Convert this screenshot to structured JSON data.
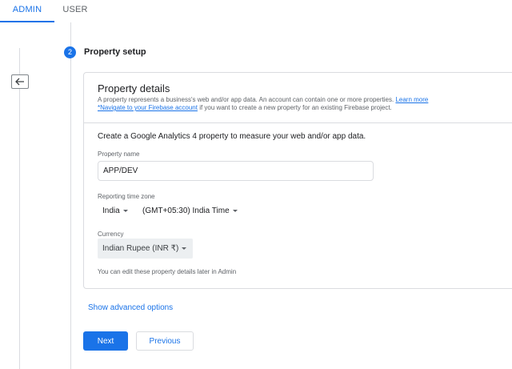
{
  "tabs": {
    "admin": "ADMIN",
    "user": "USER"
  },
  "step": {
    "number": "2",
    "title": "Property setup"
  },
  "card": {
    "title": "Property details",
    "desc1": "A property represents a business's web and/or app data. An account can contain one or more properties.",
    "learn_more": "Learn more",
    "navigate_link": "*Navigate to your Firebase account",
    "desc2_suffix": " if you want to create a new property for an existing Firebase project.",
    "create_text": "Create a Google Analytics 4 property to measure your web and/or app data.",
    "property_name_label": "Property name",
    "property_name_value": "APP/DEV",
    "timezone_label": "Reporting time zone",
    "country": "India",
    "timezone": "(GMT+05:30) India Time",
    "currency_label": "Currency",
    "currency": "Indian Rupee (INR ₹)",
    "note": "You can edit these property details later in Admin"
  },
  "advanced_link": "Show advanced options",
  "buttons": {
    "next": "Next",
    "previous": "Previous"
  },
  "icons": {
    "back": "arrow-left-icon",
    "dropdown": "caret-down-icon"
  },
  "colors": {
    "accent": "#1a73e8"
  }
}
